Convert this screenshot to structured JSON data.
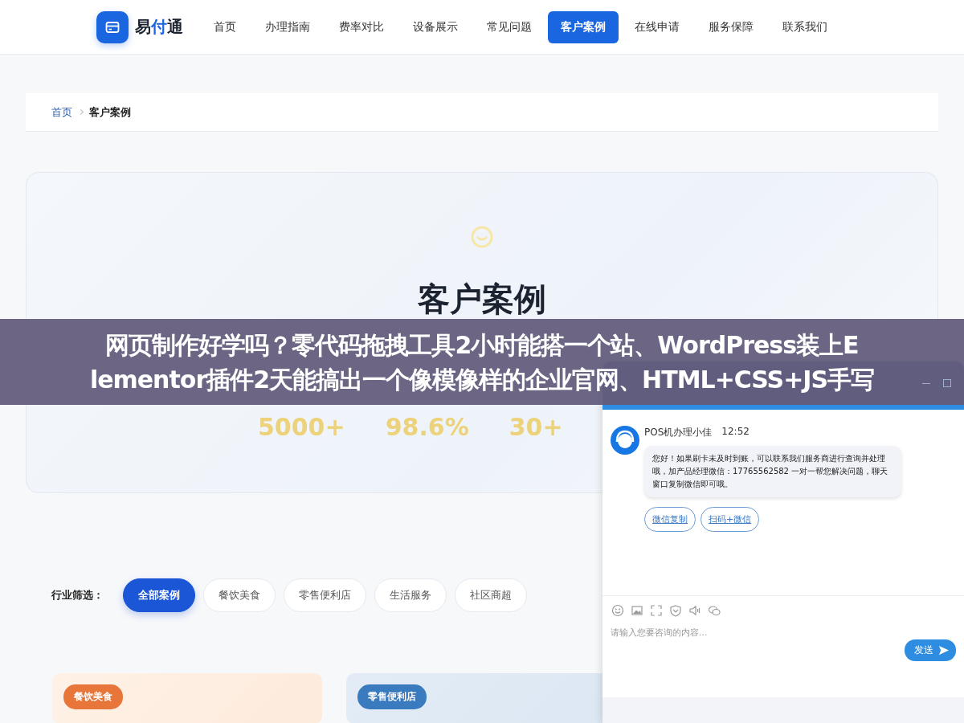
{
  "nav": {
    "brand_parts": [
      {
        "text": "易",
        "accent": false
      },
      {
        "text": "付",
        "accent": true
      },
      {
        "text": "通",
        "accent": false
      }
    ],
    "items": [
      {
        "label": "首页",
        "selected": false
      },
      {
        "label": "办理指南",
        "selected": false
      },
      {
        "label": "费率对比",
        "selected": false
      },
      {
        "label": "设备展示",
        "selected": false
      },
      {
        "label": "常见问题",
        "selected": false
      },
      {
        "label": "客户案例",
        "selected": true
      },
      {
        "label": "在线申请",
        "selected": false
      },
      {
        "label": "服务保障",
        "selected": false
      },
      {
        "label": "联系我们",
        "selected": false
      }
    ]
  },
  "breadcrumb": {
    "items": [
      {
        "label": "首页",
        "current": false
      },
      {
        "label": "客户案例",
        "current": true
      }
    ]
  },
  "hero": {
    "title": "客户案例",
    "stats": [
      {
        "value": "5000+"
      },
      {
        "value": "98.6%"
      },
      {
        "value": "30+"
      }
    ]
  },
  "filter": {
    "label": "行业筛选：",
    "options": [
      {
        "label": "全部案例",
        "selected": true
      },
      {
        "label": "餐饮美食",
        "selected": false
      },
      {
        "label": "零售便利店",
        "selected": false
      },
      {
        "label": "生活服务",
        "selected": false
      },
      {
        "label": "社区商超",
        "selected": false
      }
    ]
  },
  "cases": [
    {
      "tag": "餐饮美食",
      "color": "#e8763a"
    },
    {
      "tag": "零售便利店",
      "color": "#3a7bbf"
    }
  ],
  "chat": {
    "sender": "POS机办理小佳",
    "time": "12:52",
    "message": "您好！如果刷卡未及时到账，可以联系我们服务商进行查询并处理哦，加产品经理微信：17765562582 一对一帮您解决问题，聊天窗口复制微信即可哦。",
    "actions": [
      "微信复制",
      "扫码+微信"
    ],
    "input": {
      "placeholder": "请输入您要咨询的内容..."
    },
    "send": "发送"
  },
  "banner": {
    "lines": [
      "网页制作好学吗？零代码拖拽工具2小时能搭一个站、WordPress装上E",
      "lementor插件2天能搞出一个像模像样的企业官网、HTML+CSS+JS手写"
    ]
  }
}
